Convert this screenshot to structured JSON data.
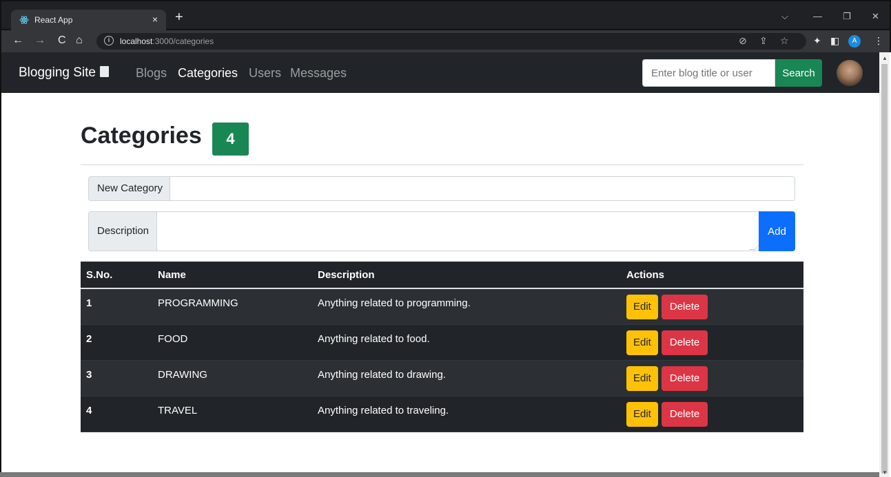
{
  "browser": {
    "tab_title": "React App",
    "tab_close": "×",
    "new_tab": "+",
    "url_host": "localhost",
    "url_path": ":3000/categories",
    "window_controls": [
      "⌵",
      "—",
      "❐",
      "✕"
    ]
  },
  "navbar": {
    "brand": "Blogging Site",
    "links": [
      {
        "label": "Blogs",
        "active": false
      },
      {
        "label": "Categories",
        "active": true
      },
      {
        "label": "Users",
        "active": false
      },
      {
        "label": "Messages",
        "active": false
      }
    ],
    "search_placeholder": "Enter blog title or user",
    "search_button": "Search"
  },
  "profile_initial": "A",
  "page": {
    "title": "Categories",
    "count": "4"
  },
  "form": {
    "new_category_label": "New Category",
    "new_category_value": "",
    "description_label": "Description",
    "description_value": "",
    "add_button": "Add"
  },
  "table": {
    "headers": [
      "S.No.",
      "Name",
      "Description",
      "Actions"
    ],
    "rows": [
      {
        "sno": "1",
        "name": "PROGRAMMING",
        "description": "Anything related to programming."
      },
      {
        "sno": "2",
        "name": "FOOD",
        "description": "Anything related to food."
      },
      {
        "sno": "3",
        "name": "DRAWING",
        "description": "Anything related to drawing."
      },
      {
        "sno": "4",
        "name": "TRAVEL",
        "description": "Anything related to traveling."
      }
    ],
    "edit_label": "Edit",
    "delete_label": "Delete"
  },
  "colors": {
    "navbar_bg": "#212529",
    "success": "#198754",
    "primary": "#0d6efd",
    "warning": "#ffc107",
    "danger": "#dc3545"
  }
}
